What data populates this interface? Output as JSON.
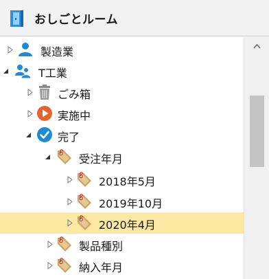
{
  "header": {
    "title": "おしごとルーム"
  },
  "tree": {
    "items": [
      {
        "label": "製造業",
        "icon": "person-icon",
        "expanded": false,
        "selected": false
      },
      {
        "label": "T工業",
        "icon": "people-icon",
        "expanded": true,
        "selected": false
      },
      {
        "label": "ごみ箱",
        "icon": "trash-icon",
        "expanded": false,
        "selected": false
      },
      {
        "label": "実施中",
        "icon": "play-circle-icon",
        "expanded": false,
        "selected": false
      },
      {
        "label": "完了",
        "icon": "check-circle-icon",
        "expanded": true,
        "selected": false
      },
      {
        "label": "受注年月",
        "icon": "tag-icon",
        "expanded": true,
        "selected": false
      },
      {
        "label": "2018年5月",
        "icon": "tag-icon",
        "expanded": false,
        "selected": false
      },
      {
        "label": "2019年10月",
        "icon": "tag-icon",
        "expanded": false,
        "selected": false
      },
      {
        "label": "2020年4月",
        "icon": "tag-icon",
        "expanded": false,
        "selected": true
      },
      {
        "label": "製品種別",
        "icon": "tag-icon",
        "expanded": false,
        "selected": false
      },
      {
        "label": "納入年月",
        "icon": "tag-icon",
        "expanded": false,
        "selected": false
      }
    ]
  },
  "colors": {
    "selection": "#fce7a3",
    "accent_blue": "#1f8ad6",
    "play_orange": "#e8632c",
    "tag_tan": "#caa466"
  }
}
